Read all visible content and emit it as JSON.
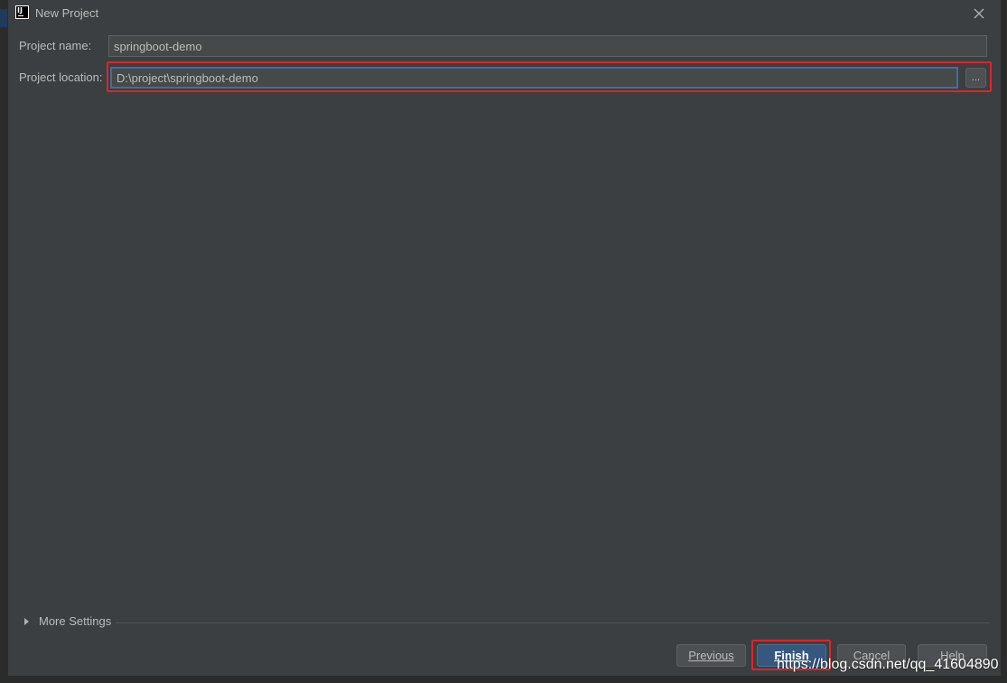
{
  "window": {
    "title": "New Project",
    "icon": "intellij-idea-icon"
  },
  "form": {
    "name_label": "Project name:",
    "name_value": "springboot-demo",
    "location_label": "Project location:",
    "location_value": "D:\\project\\springboot-demo",
    "browse_label": "..."
  },
  "more_settings": {
    "label": "More Settings",
    "expanded": false
  },
  "buttons": {
    "previous": "Previous",
    "finish": "Finish",
    "cancel": "Cancel",
    "help": "Help"
  },
  "watermark": "https://blog.csdn.net/qq_41604890",
  "colors": {
    "background": "#3c3f41",
    "input_bg": "#45494a",
    "focus_border": "#466d94",
    "primary_button": "#365880",
    "annotation_red": "#e0242b",
    "text": "#bbbbbb"
  }
}
